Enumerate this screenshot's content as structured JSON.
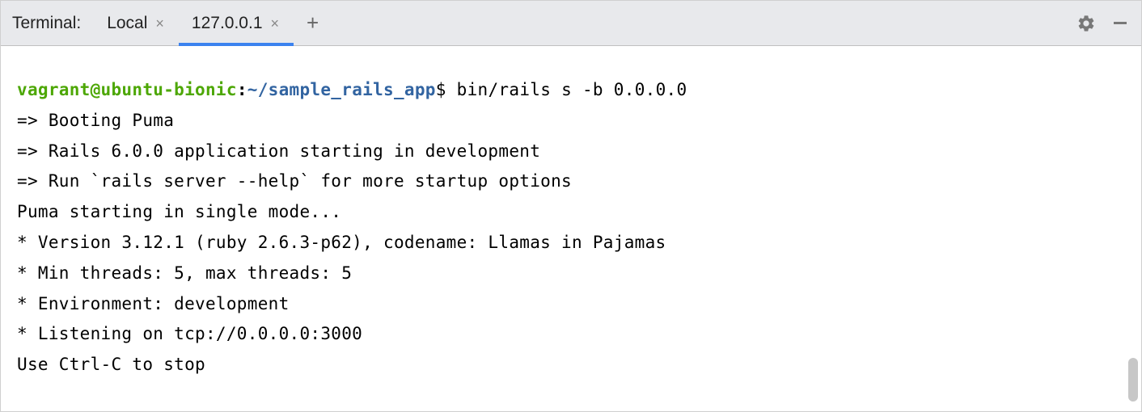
{
  "tab_bar": {
    "title": "Terminal:",
    "tabs": [
      {
        "label": "Local",
        "active": false
      },
      {
        "label": "127.0.0.1",
        "active": true
      }
    ]
  },
  "prompt": {
    "user_host": "vagrant@ubuntu-bionic",
    "path": "~/sample_rails_app",
    "symbol": "$",
    "command": "bin/rails s -b 0.0.0.0"
  },
  "output": [
    "=> Booting Puma",
    "=> Rails 6.0.0 application starting in development",
    "=> Run `rails server --help` for more startup options",
    "Puma starting in single mode...",
    "* Version 3.12.1 (ruby 2.6.3-p62), codename: Llamas in Pajamas",
    "* Min threads: 5, max threads: 5",
    "* Environment: development",
    "* Listening on tcp://0.0.0.0:3000",
    "Use Ctrl-C to stop"
  ]
}
